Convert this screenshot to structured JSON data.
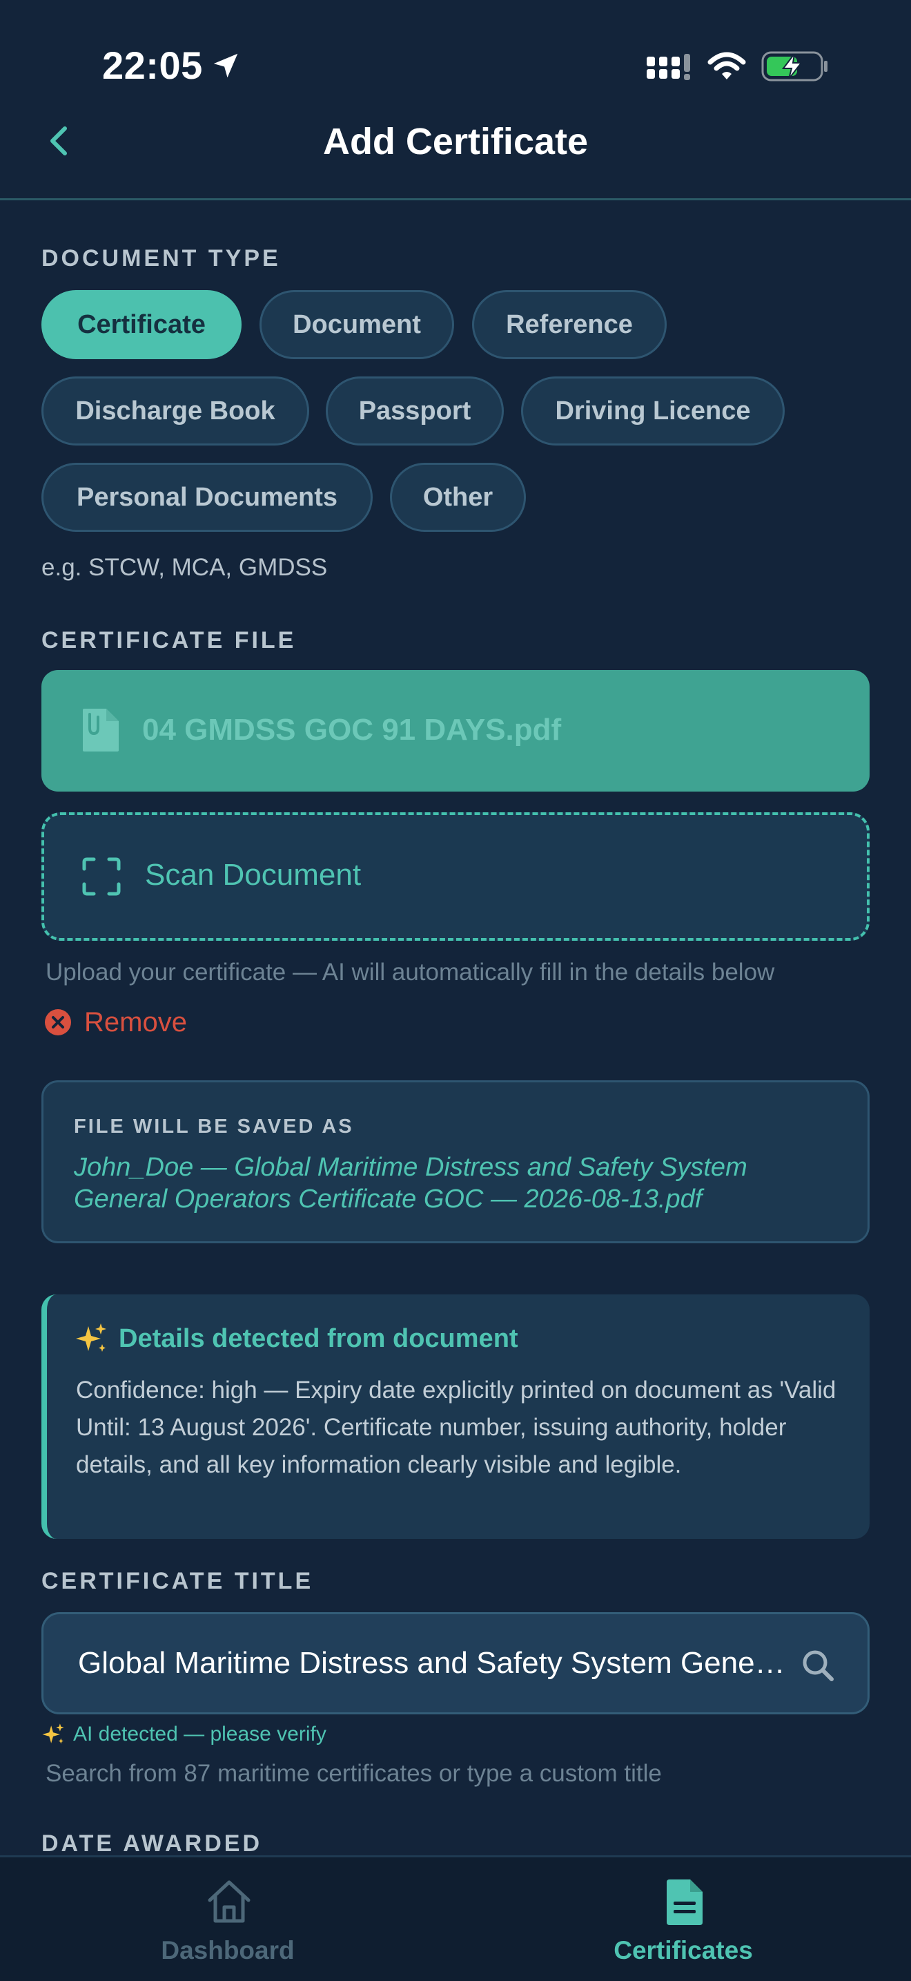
{
  "status_bar": {
    "time": "22:05"
  },
  "header": {
    "title": "Add Certificate"
  },
  "document_type": {
    "label": "DOCUMENT TYPE",
    "options": [
      "Certificate",
      "Document",
      "Reference",
      "Discharge Book",
      "Passport",
      "Driving Licence",
      "Personal Documents",
      "Other"
    ],
    "selected": "Certificate",
    "hint": "e.g. STCW, MCA, GMDSS"
  },
  "certificate_file": {
    "label": "CERTIFICATE FILE",
    "file_name": "04 GMDSS GOC 91 DAYS.pdf",
    "scan_label": "Scan Document",
    "upload_hint": "Upload your certificate — AI will automatically fill in the details below",
    "remove_label": "Remove"
  },
  "saved_as": {
    "label": "FILE WILL BE SAVED AS",
    "file_name": "John_Doe — Global Maritime Distress and Safety System General Operators Certificate GOC — 2026-08-13.pdf"
  },
  "ai_detection": {
    "title": "Details detected from document",
    "body": "Confidence: high — Expiry date explicitly printed on document as 'Valid Until: 13 August 2026'. Certificate number, issuing authority, holder details, and all key information clearly visible and legible."
  },
  "certificate_title": {
    "label": "CERTIFICATE TITLE",
    "value": "Global Maritime Distress and Safety System General Operators Certificate GOC",
    "ai_note": "AI detected — please verify",
    "hint": "Search from 87 maritime certificates or type a custom title"
  },
  "date_awarded": {
    "label": "DATE AWARDED"
  },
  "tab_bar": {
    "items": [
      {
        "label": "Dashboard",
        "icon": "home-icon"
      },
      {
        "label": "Certificates",
        "icon": "document-icon",
        "active": true
      }
    ]
  },
  "colors": {
    "background": "#13243a",
    "accent": "#4cc1ae",
    "card": "#1c3850",
    "danger": "#d9503f"
  }
}
